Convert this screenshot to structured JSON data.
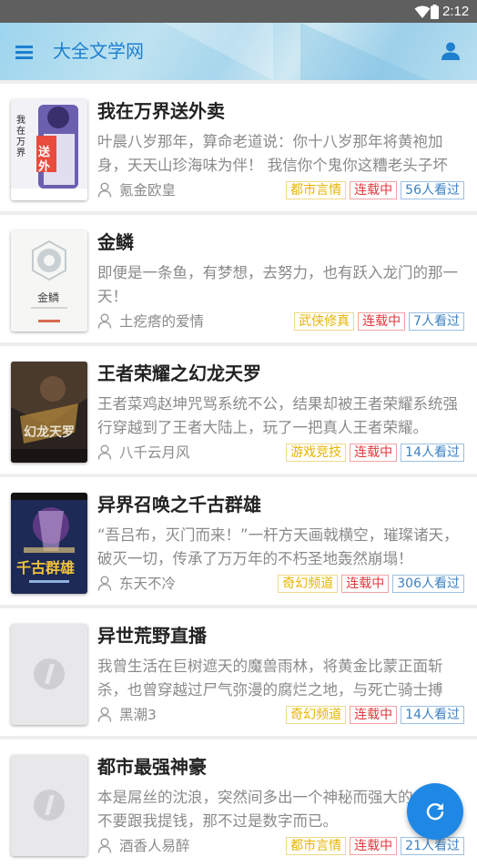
{
  "status_bar": {
    "time": "2:12"
  },
  "app_bar": {
    "title": "大全文学网",
    "icons": [
      "menu-icon",
      "user-icon"
    ]
  },
  "books": [
    {
      "title": "我在万界送外卖",
      "description": "叶晨八岁那年，算命老道说：你十八岁那年将黄袍加身，天天山珍海味为伴！ 我信你个鬼你这糟老头子坏得很！",
      "author": "氪金欧皇",
      "category": "都市言情",
      "status": "连载中",
      "readers": "56人看过",
      "cover": {
        "style": "image",
        "text": "我在万界送外卖",
        "colors": [
          "#5a4fa0",
          "#e94b3c",
          "#f2f2f2"
        ]
      }
    },
    {
      "title": "金鳞",
      "description": "即便是一条鱼，有梦想，去努力，也有跃入龙门的那一天！",
      "author": "土疙瘩的爱情",
      "category": "武侠修真",
      "status": "连载中",
      "readers": "7人看过",
      "cover": {
        "style": "image",
        "text": "金鳞",
        "colors": [
          "#f3f4f2",
          "#8f9aa0"
        ]
      }
    },
    {
      "title": "王者荣耀之幻龙天罗",
      "description": "王者菜鸡赵坤咒骂系统不公，结果却被王者荣耀系统强行穿越到了王者大陆上，玩了一把真人王者荣耀。",
      "author": "八千云月风",
      "category": "游戏竞技",
      "status": "连载中",
      "readers": "14人看过",
      "cover": {
        "style": "image",
        "text": "幻龙天罗",
        "colors": [
          "#2a2320",
          "#b98b3c",
          "#d7cfc0"
        ]
      }
    },
    {
      "title": "异界召唤之千古群雄",
      "description": "“吾吕布，灭门而来！”一杆方天画戟横空，璀璨诸天，破灭一切，传承了万万年的不朽圣地轰然崩塌！",
      "author": "东天不冷",
      "category": "奇幻频道",
      "status": "连载中",
      "readers": "306人看过",
      "cover": {
        "style": "image",
        "text": "千古群雄",
        "colors": [
          "#1d2a55",
          "#e0a92d",
          "#6f3d8f"
        ]
      }
    },
    {
      "title": "异世荒野直播",
      "description": "我曾生活在巨树遮天的魔兽雨林，将黄金比蒙正面斩杀，也曾穿越过尸气弥漫的腐烂之地，与死亡骑士搏斗。",
      "author": "黑潮3",
      "category": "奇幻频道",
      "status": "连载中",
      "readers": "14人看过",
      "cover": {
        "style": "placeholder"
      }
    },
    {
      "title": "都市最强神豪",
      "description": "本是屌丝的沈浪，突然间多出一个神秘而强大的父亲。不要跟我提钱，那不过是数字而已。",
      "author": "酒香人易醉",
      "category": "都市言情",
      "status": "连载中",
      "readers": "21人看过",
      "cover": {
        "style": "placeholder"
      }
    }
  ],
  "fab": {
    "icon": "refresh-icon"
  },
  "colors": {
    "accent": "#1f88e5",
    "title_blue": "#1e7fcf",
    "tag_category": "#e6b400",
    "tag_status": "#e0383d",
    "tag_readers": "#3b82c4"
  }
}
